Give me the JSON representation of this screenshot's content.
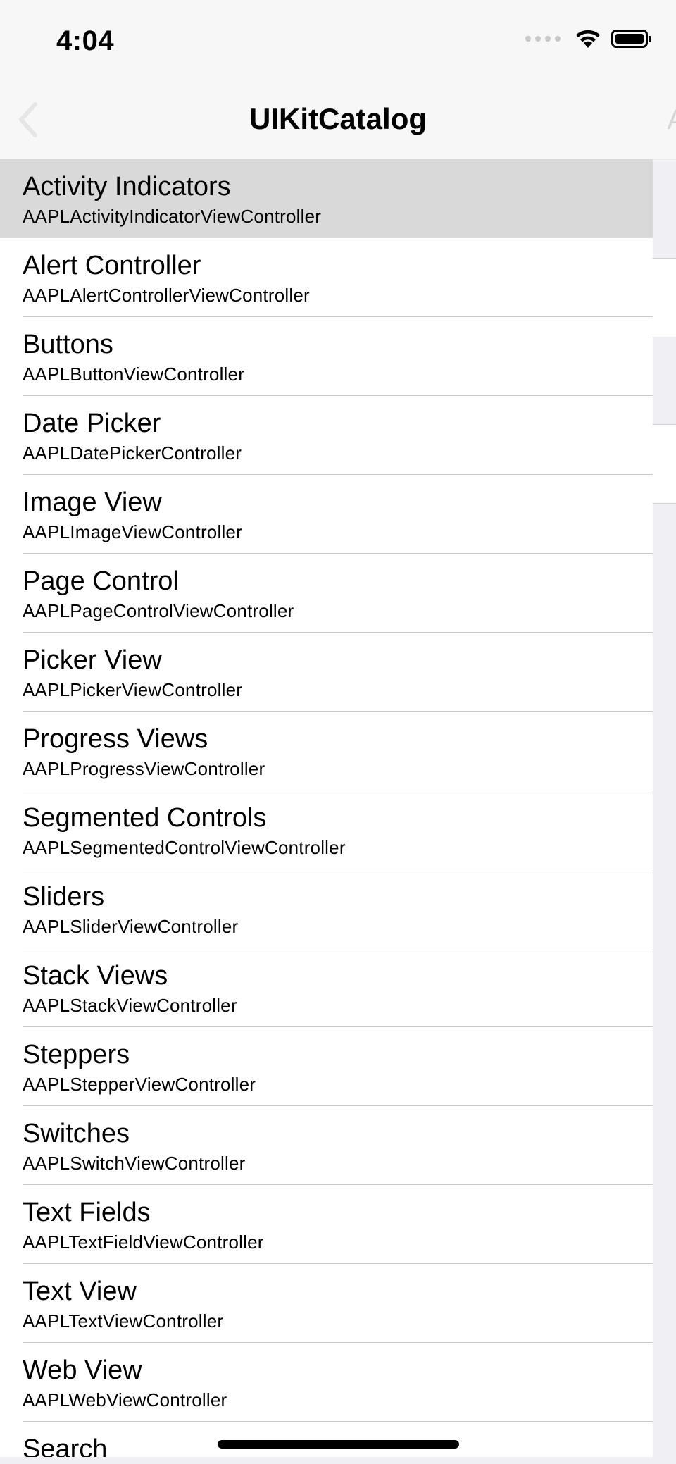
{
  "status": {
    "time": "4:04"
  },
  "nav": {
    "title": "UIKitCatalog",
    "right_ghost": "A"
  },
  "list": {
    "items": [
      {
        "title": "Activity Indicators",
        "subtitle": "AAPLActivityIndicatorViewController"
      },
      {
        "title": "Alert Controller",
        "subtitle": "AAPLAlertControllerViewController"
      },
      {
        "title": "Buttons",
        "subtitle": "AAPLButtonViewController"
      },
      {
        "title": "Date Picker",
        "subtitle": "AAPLDatePickerController"
      },
      {
        "title": "Image View",
        "subtitle": "AAPLImageViewController"
      },
      {
        "title": "Page Control",
        "subtitle": "AAPLPageControlViewController"
      },
      {
        "title": "Picker View",
        "subtitle": "AAPLPickerViewController"
      },
      {
        "title": "Progress Views",
        "subtitle": "AAPLProgressViewController"
      },
      {
        "title": "Segmented Controls",
        "subtitle": "AAPLSegmentedControlViewController"
      },
      {
        "title": "Sliders",
        "subtitle": "AAPLSliderViewController"
      },
      {
        "title": "Stack Views",
        "subtitle": "AAPLStackViewController"
      },
      {
        "title": "Steppers",
        "subtitle": "AAPLStepperViewController"
      },
      {
        "title": "Switches",
        "subtitle": "AAPLSwitchViewController"
      },
      {
        "title": "Text Fields",
        "subtitle": "AAPLTextFieldViewController"
      },
      {
        "title": "Text View",
        "subtitle": "AAPLTextViewController"
      },
      {
        "title": "Web View",
        "subtitle": "AAPLWebViewController"
      },
      {
        "title": "Search"
      }
    ]
  }
}
